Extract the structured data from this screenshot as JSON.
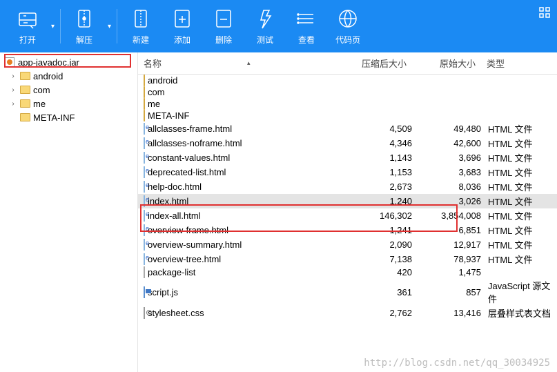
{
  "toolbar": {
    "open": "打开",
    "extract": "解压",
    "new": "新建",
    "add": "添加",
    "delete": "删除",
    "test": "测试",
    "view": "查看",
    "codepage": "代码页"
  },
  "tree": {
    "root": "app-javadoc.jar",
    "items": [
      "android",
      "com",
      "me",
      "META-INF"
    ]
  },
  "columns": {
    "name": "名称",
    "compressed": "压缩后大小",
    "original": "原始大小",
    "type": "类型"
  },
  "typeLabels": {
    "html": "HTML 文件",
    "js": "JavaScript 源文件",
    "css": "层叠样式表文档"
  },
  "files": [
    {
      "name": "android",
      "kind": "folder",
      "comp": "",
      "orig": "",
      "type": ""
    },
    {
      "name": "com",
      "kind": "folder",
      "comp": "",
      "orig": "",
      "type": ""
    },
    {
      "name": "me",
      "kind": "folder",
      "comp": "",
      "orig": "",
      "type": ""
    },
    {
      "name": "META-INF",
      "kind": "folder",
      "comp": "",
      "orig": "",
      "type": ""
    },
    {
      "name": "allclasses-frame.html",
      "kind": "html",
      "comp": "4,509",
      "orig": "49,480",
      "type": "HTML 文件"
    },
    {
      "name": "allclasses-noframe.html",
      "kind": "html",
      "comp": "4,346",
      "orig": "42,600",
      "type": "HTML 文件"
    },
    {
      "name": "constant-values.html",
      "kind": "html",
      "comp": "1,143",
      "orig": "3,696",
      "type": "HTML 文件"
    },
    {
      "name": "deprecated-list.html",
      "kind": "html",
      "comp": "1,153",
      "orig": "3,683",
      "type": "HTML 文件"
    },
    {
      "name": "help-doc.html",
      "kind": "html",
      "comp": "2,673",
      "orig": "8,036",
      "type": "HTML 文件"
    },
    {
      "name": "index.html",
      "kind": "html",
      "comp": "1,240",
      "orig": "3,026",
      "type": "HTML 文件",
      "selected": true
    },
    {
      "name": "index-all.html",
      "kind": "html",
      "comp": "146,302",
      "orig": "3,854,008",
      "type": "HTML 文件"
    },
    {
      "name": "overview-frame.html",
      "kind": "html",
      "comp": "1,241",
      "orig": "6,851",
      "type": "HTML 文件"
    },
    {
      "name": "overview-summary.html",
      "kind": "html",
      "comp": "2,090",
      "orig": "12,917",
      "type": "HTML 文件"
    },
    {
      "name": "overview-tree.html",
      "kind": "html",
      "comp": "7,138",
      "orig": "78,937",
      "type": "HTML 文件"
    },
    {
      "name": "package-list",
      "kind": "blank",
      "comp": "420",
      "orig": "1,475",
      "type": ""
    },
    {
      "name": "script.js",
      "kind": "js",
      "comp": "361",
      "orig": "857",
      "type": "JavaScript 源文件"
    },
    {
      "name": "stylesheet.css",
      "kind": "css",
      "comp": "2,762",
      "orig": "13,416",
      "type": "层叠样式表文档"
    }
  ],
  "watermark": "http://blog.csdn.net/qq_30034925"
}
